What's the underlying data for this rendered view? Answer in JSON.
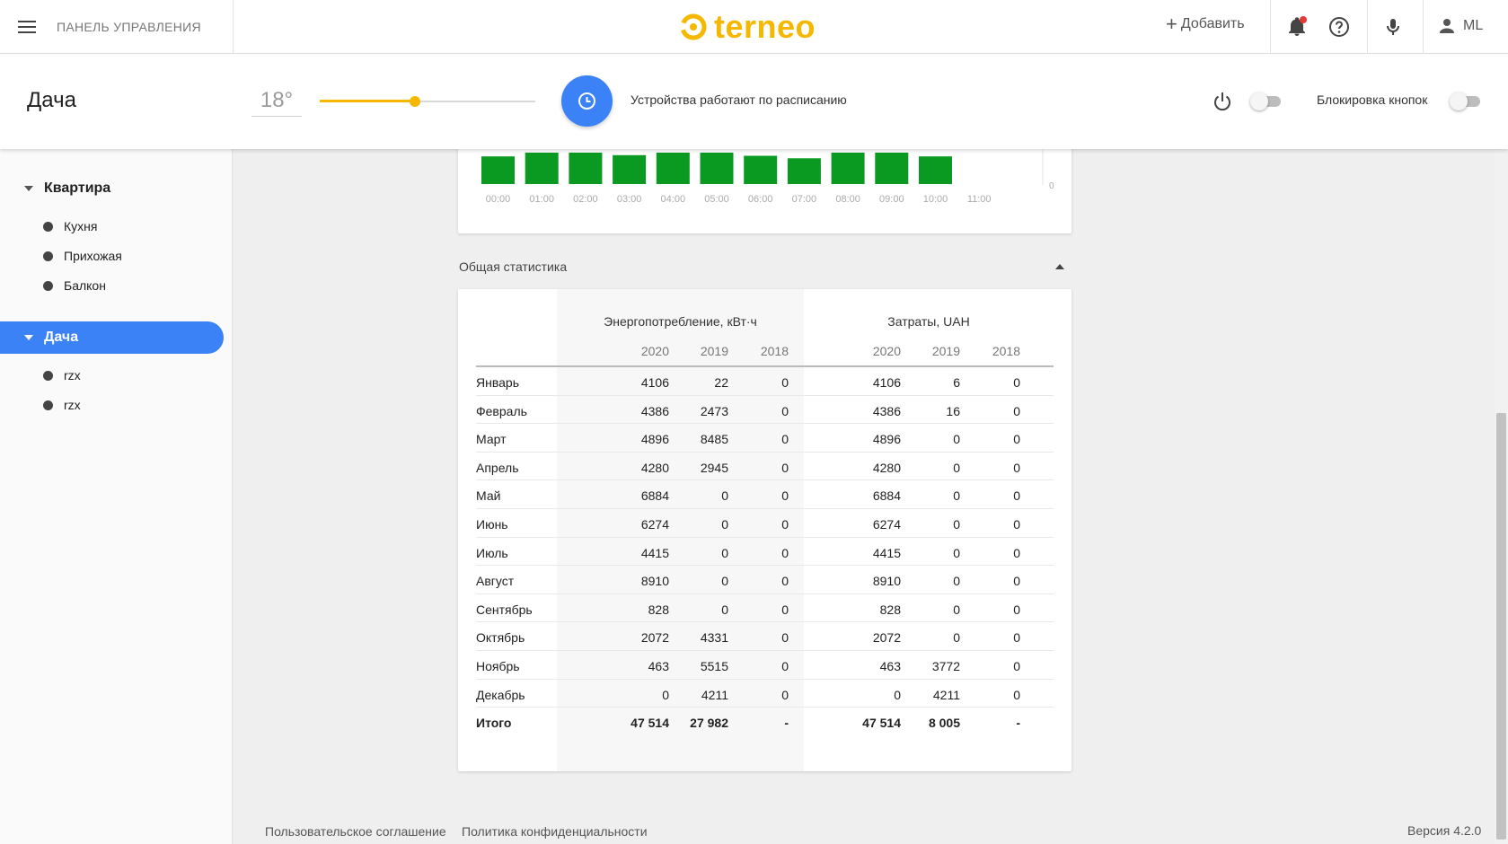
{
  "topbar": {
    "panel_title": "ПАНЕЛЬ УПРАВЛЕНИЯ",
    "logo_text": "terneo",
    "add_label": "Добавить",
    "user_initials": "ML",
    "brand_color": "#f5b700",
    "notification_dot_color": "#e53935"
  },
  "device": {
    "name": "Дача",
    "temperature": "18°",
    "slider_level": 0.44,
    "schedule_text": "Устройства работают по расписанию",
    "power_on": false,
    "lock_label": "Блокировка кнопок",
    "lock_on": false,
    "accent_color": "#3b82f6"
  },
  "sidebar": {
    "groups": [
      {
        "label": "Квартира",
        "active": false,
        "rooms": [
          "Кухня",
          "Прихожая",
          "Балкон"
        ]
      },
      {
        "label": "Дача",
        "active": true,
        "rooms": [
          "rzx",
          "rzx"
        ]
      }
    ]
  },
  "chart_data": {
    "type": "bar",
    "categories": [
      "00:00",
      "01:00",
      "02:00",
      "03:00",
      "04:00",
      "05:00",
      "06:00",
      "07:00",
      "08:00",
      "09:00",
      "10:00",
      "11:00"
    ],
    "values_visible_fraction": [
      0.88,
      1.0,
      1.0,
      0.92,
      1.0,
      1.0,
      0.9,
      0.82,
      1.0,
      1.0,
      0.88,
      0
    ],
    "y_tick_visible": "0",
    "bar_color": "#0a9a21"
  },
  "stats": {
    "section_title": "Общая статистика",
    "energy_header": "Энергопотребление, кВт·ч",
    "cost_header": "Затраты, UAH",
    "years": [
      "2020",
      "2019",
      "2018"
    ],
    "rows": [
      {
        "month": "Январь",
        "energy": [
          "4106",
          "22",
          "0"
        ],
        "cost": [
          "4106",
          "6",
          "0"
        ]
      },
      {
        "month": "Февраль",
        "energy": [
          "4386",
          "2473",
          "0"
        ],
        "cost": [
          "4386",
          "16",
          "0"
        ]
      },
      {
        "month": "Март",
        "energy": [
          "4896",
          "8485",
          "0"
        ],
        "cost": [
          "4896",
          "0",
          "0"
        ]
      },
      {
        "month": "Апрель",
        "energy": [
          "4280",
          "2945",
          "0"
        ],
        "cost": [
          "4280",
          "0",
          "0"
        ]
      },
      {
        "month": "Май",
        "energy": [
          "6884",
          "0",
          "0"
        ],
        "cost": [
          "6884",
          "0",
          "0"
        ]
      },
      {
        "month": "Июнь",
        "energy": [
          "6274",
          "0",
          "0"
        ],
        "cost": [
          "6274",
          "0",
          "0"
        ]
      },
      {
        "month": "Июль",
        "energy": [
          "4415",
          "0",
          "0"
        ],
        "cost": [
          "4415",
          "0",
          "0"
        ]
      },
      {
        "month": "Август",
        "energy": [
          "8910",
          "0",
          "0"
        ],
        "cost": [
          "8910",
          "0",
          "0"
        ]
      },
      {
        "month": "Сентябрь",
        "energy": [
          "828",
          "0",
          "0"
        ],
        "cost": [
          "828",
          "0",
          "0"
        ]
      },
      {
        "month": "Октябрь",
        "energy": [
          "2072",
          "4331",
          "0"
        ],
        "cost": [
          "2072",
          "0",
          "0"
        ]
      },
      {
        "month": "Ноябрь",
        "energy": [
          "463",
          "5515",
          "0"
        ],
        "cost": [
          "463",
          "3772",
          "0"
        ]
      },
      {
        "month": "Декабрь",
        "energy": [
          "0",
          "4211",
          "0"
        ],
        "cost": [
          "0",
          "4211",
          "0"
        ]
      }
    ],
    "total": {
      "month": "Итого",
      "energy": [
        "47 514",
        "27 982",
        "-"
      ],
      "cost": [
        "47 514",
        "8 005",
        "-"
      ]
    }
  },
  "footer": {
    "agreement": "Пользовательское соглашение",
    "privacy": "Политика конфиденциальности",
    "version": "Версия 4.2.0"
  }
}
